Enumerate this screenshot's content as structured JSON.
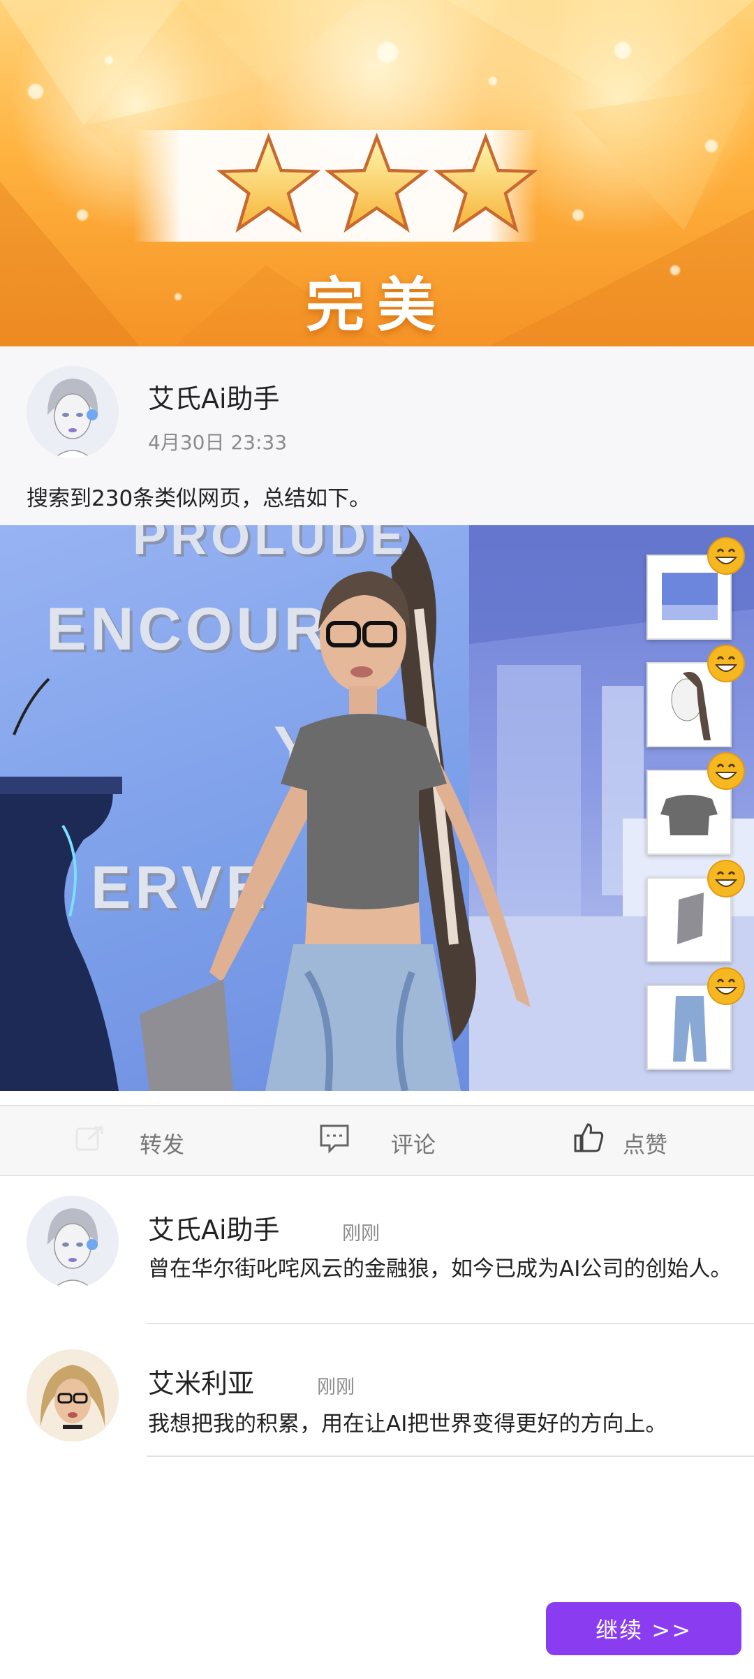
{
  "result": {
    "stars": 3,
    "rating_label": "完美"
  },
  "post": {
    "author": "艾氏Ai助手",
    "time": "4月30日 23:33",
    "text": "搜索到230条类似网页，总结如下。"
  },
  "scene": {
    "wall_words": [
      "PROLUDE",
      "ENCOURA",
      "YO",
      "ERVE"
    ],
    "outfit_items": [
      "background-icon",
      "hair-icon",
      "top-icon",
      "laptop-icon",
      "jeans-icon"
    ]
  },
  "actions": {
    "share": "转发",
    "comment": "评论",
    "like": "点赞"
  },
  "comments": [
    {
      "author": "艾氏Ai助手",
      "time": "刚刚",
      "text": "曾在华尔街叱咤风云的金融狼，如今已成为AI公司的创始人。"
    },
    {
      "author": "艾米利亚",
      "time": "刚刚",
      "text": "我想把我的积累，用在让AI把世界变得更好的方向上。"
    }
  ],
  "continue_label": "继续 >>",
  "colors": {
    "accent": "#8a3df0",
    "banner": "#ffb23f"
  }
}
